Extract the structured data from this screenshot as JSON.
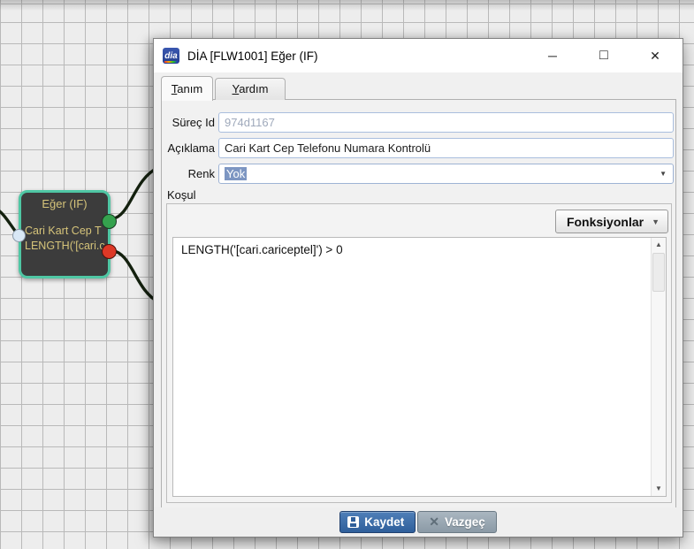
{
  "window": {
    "icon": "dia",
    "title": "DİA [FLW1001] Eğer (IF)",
    "minimize_glyph": "─",
    "maximize_glyph": "□",
    "close_glyph": "✕"
  },
  "tabs": {
    "tanim": {
      "accel": "T",
      "rest": "anım"
    },
    "yardim": {
      "accel": "Y",
      "rest": "ardım"
    }
  },
  "form": {
    "surec_id": {
      "label": "Süreç Id",
      "value": "974d1167"
    },
    "aciklama": {
      "label": "Açıklama",
      "value": "Cari Kart Cep Telefonu Numara Kontrolü"
    },
    "renk": {
      "label": "Renk",
      "value": "Yok",
      "dropdown_glyph": "▼"
    },
    "kosul": {
      "label": "Koşul",
      "functions_button": "Fonksiyonlar",
      "functions_dropdown_glyph": "▼",
      "expression": "LENGTH('[cari.cariceptel]') > 0"
    }
  },
  "scrollbar": {
    "up_glyph": "▲",
    "down_glyph": "▼"
  },
  "footer": {
    "save_label": "Kaydet",
    "cancel_label": "Vazgeç",
    "cancel_icon_glyph": "✕"
  },
  "node": {
    "title": "Eğer (IF)",
    "line1": "Cari Kart Cep T",
    "line2": "LENGTH('[cari.c"
  },
  "colors": {
    "accent_blue": "#2f5f9b",
    "node_border_teal": "#4fc7a4",
    "port_true_green": "#35a24e",
    "port_false_red": "#dd3826",
    "selection_blue": "#7d96c2",
    "edge_color": "#14210f",
    "grid_line": "#b9b9b9",
    "grid_bg": "#ededed"
  }
}
